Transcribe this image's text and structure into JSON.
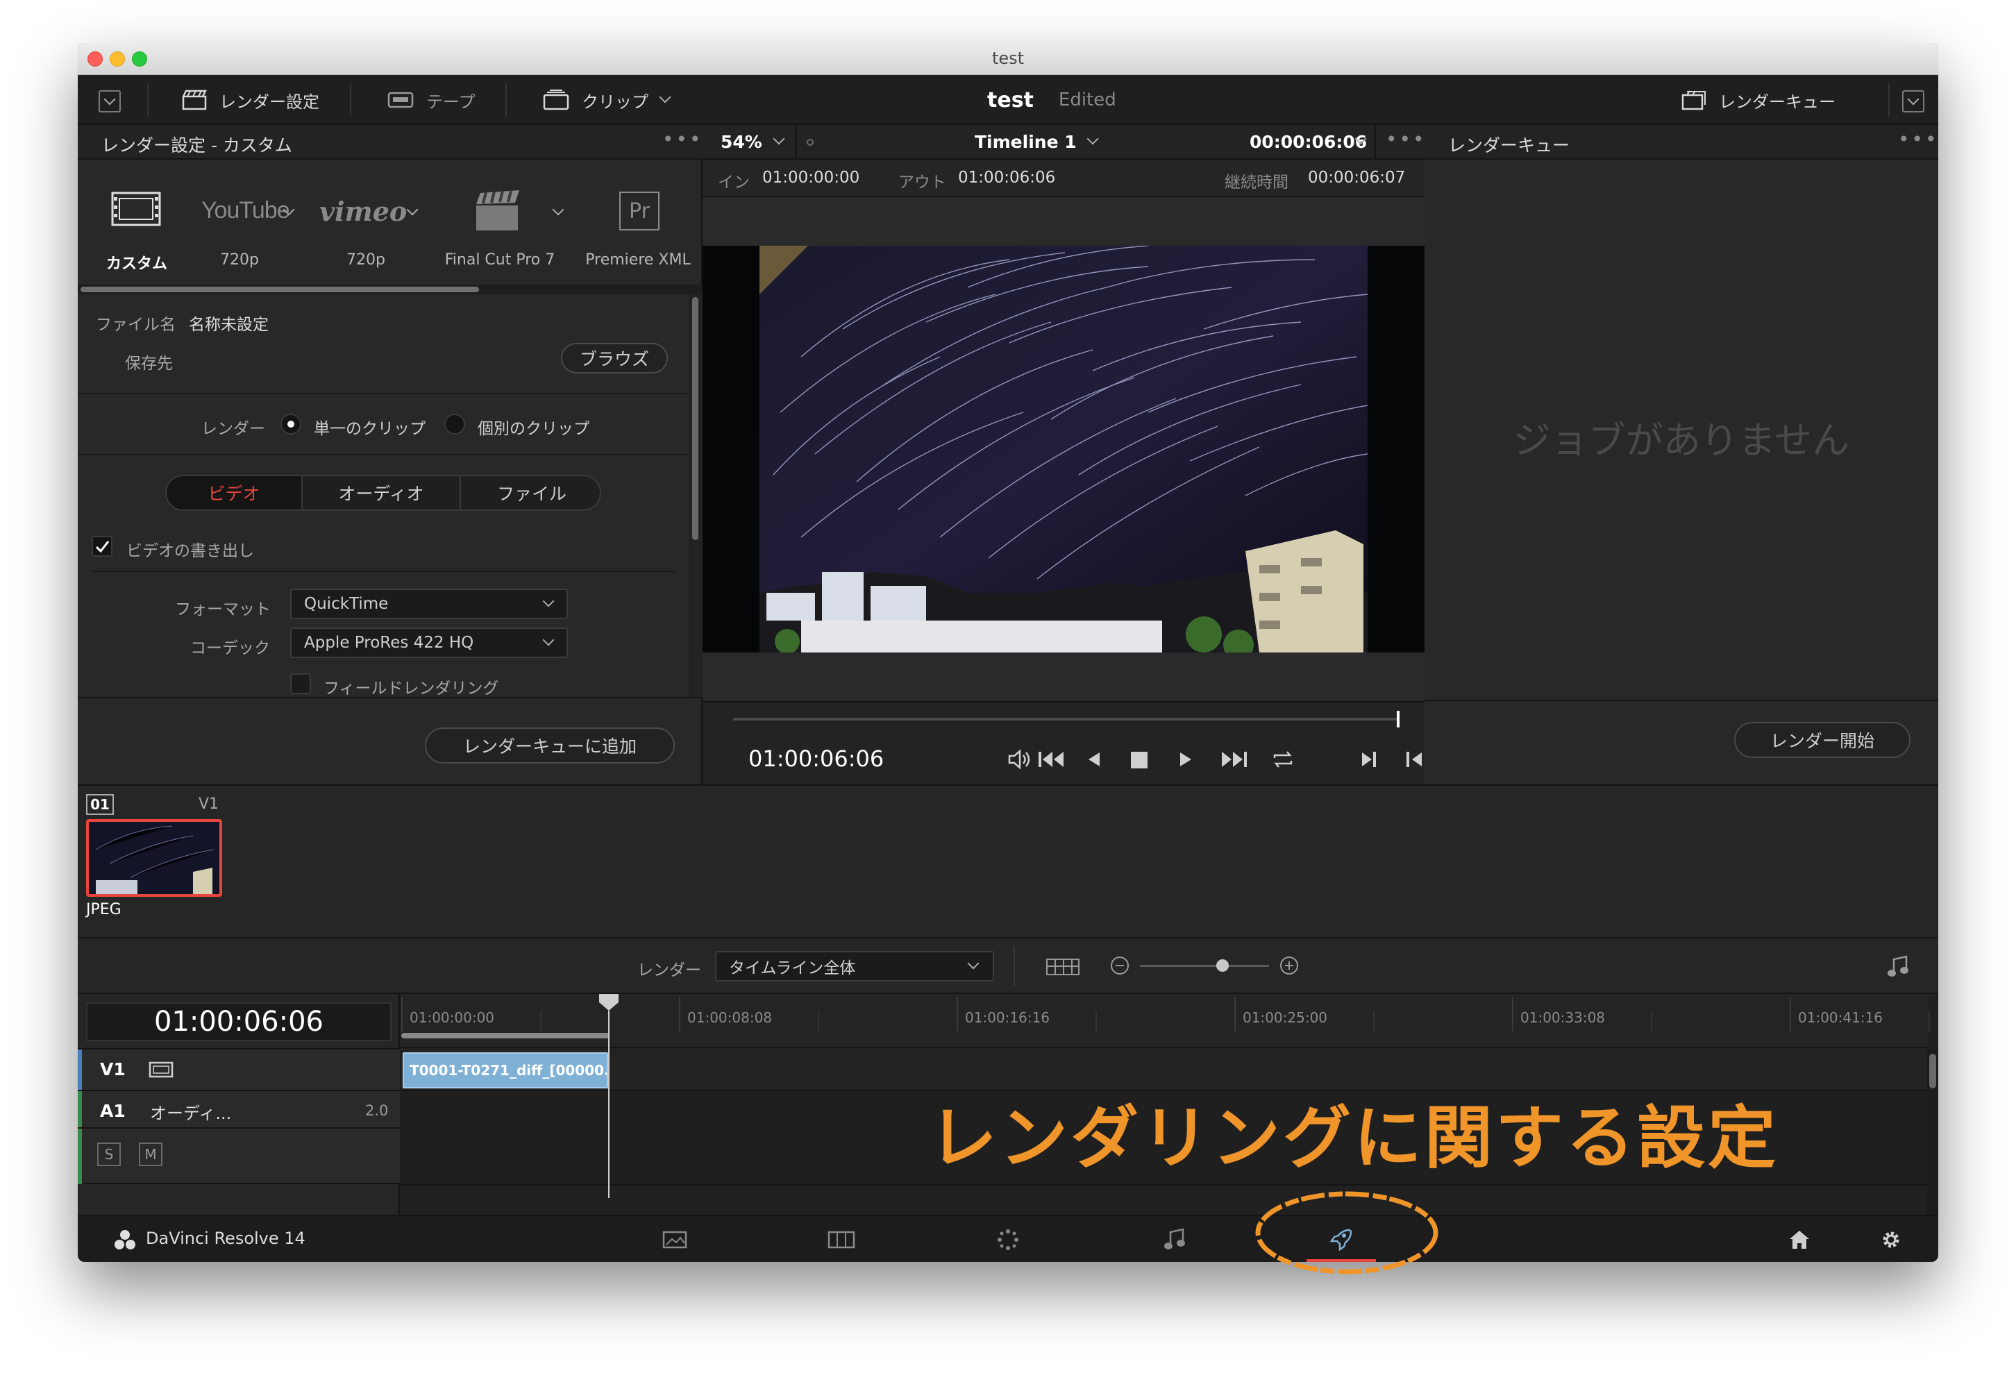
{
  "window": {
    "title": "test"
  },
  "toolbar": {
    "render_settings": "レンダー設定",
    "tape": "テープ",
    "clips": "クリップ",
    "project_name": "test",
    "project_status": "Edited",
    "render_queue": "レンダーキュー"
  },
  "render_settings": {
    "header": "レンダー設定 - カスタム",
    "presets": [
      {
        "label": "カスタム",
        "icon": "film-strip-icon"
      },
      {
        "label": "720p",
        "icon": "youtube-logo",
        "logo": "YouTube"
      },
      {
        "label": "720p",
        "icon": "vimeo-logo",
        "logo": "vimeo"
      },
      {
        "label": "Final Cut Pro 7",
        "icon": "clapper-icon"
      },
      {
        "label": "Premiere XML",
        "icon": "premiere-icon",
        "logo": "Pr"
      }
    ],
    "filename_label": "ファイル名",
    "filename_value": "名称未設定",
    "location_label": "保存先",
    "browse_label": "ブラウズ",
    "render_label": "レンダー",
    "single_clip": "単一のクリップ",
    "individual_clips": "個別のクリップ",
    "tabs": [
      "ビデオ",
      "オーディオ",
      "ファイル"
    ],
    "active_tab": "ビデオ",
    "export_video": "ビデオの書き出し",
    "format_label": "フォーマット",
    "format_value": "QuickTime",
    "codec_label": "コーデック",
    "codec_value": "Apple ProRes 422 HQ",
    "field_rendering": "フィールドレンダリング",
    "add_to_queue": "レンダーキューに追加"
  },
  "viewer": {
    "zoom": "54%",
    "timeline_name": "Timeline 1",
    "timecode_top": "00:00:06:06",
    "in_label": "イン",
    "in_value": "01:00:00:00",
    "out_label": "アウト",
    "out_value": "01:00:06:06",
    "duration_label": "継続時間",
    "duration_value": "00:00:06:07",
    "current_timecode": "01:00:06:06"
  },
  "render_queue": {
    "header": "レンダーキュー",
    "empty_message": "ジョブがありません",
    "start_render": "レンダー開始"
  },
  "clips": {
    "number": "01",
    "track": "V1",
    "type": "JPEG"
  },
  "timeline_bar": {
    "render_label": "レンダー",
    "render_range": "タイムライン全体"
  },
  "timeline": {
    "timecode": "01:00:06:06",
    "ruler": [
      "01:00:00:00",
      "01:00:08:08",
      "01:00:16:16",
      "01:00:25:00",
      "01:00:33:08",
      "01:00:41:16"
    ],
    "v1_label": "V1",
    "a1_label": "A1",
    "a1_name": "オーディ...",
    "a1_channels": "2.0",
    "solo": "S",
    "mute": "M",
    "clip_name": "T0001-T0271_diff_[00000..."
  },
  "annotation": {
    "text": "レンダリングに関する設定",
    "color": "#f0952a"
  },
  "footer": {
    "app_name": "DaVinci Resolve 14"
  },
  "colors": {
    "accent_red": "#e8453c",
    "clip_blue": "#7fb0d6",
    "annotation_orange": "#f0952a"
  }
}
